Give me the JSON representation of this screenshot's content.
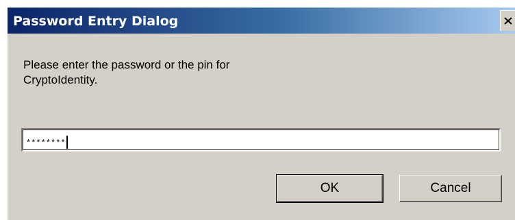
{
  "dialog": {
    "title": "Password Entry Dialog",
    "close_glyph": "✕",
    "prompt_line1": "Please enter the password or the pin for",
    "prompt_line2": "CryptoIdentity.",
    "password_value": "********",
    "ok_label": "OK",
    "cancel_label": "Cancel"
  },
  "icons": {
    "close": "close-icon"
  },
  "colors": {
    "title_gradient_start": "#0a246a",
    "title_gradient_end": "#a6caf0",
    "window_face": "#d4d0c8"
  }
}
